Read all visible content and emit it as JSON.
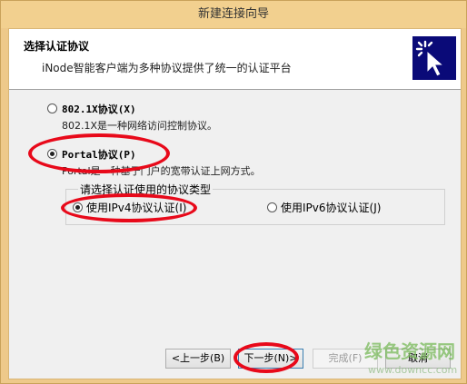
{
  "window": {
    "title": "新建连接向导"
  },
  "header": {
    "title": "选择认证协议",
    "subtitle": "iNode智能客户端为多种协议提供了统一的认证平台",
    "logo_icon": "cursor-click-icon",
    "logo_color": "#0a0a78"
  },
  "options": {
    "x8021": {
      "label": "802.1X协议(X)",
      "desc": "802.1X是一种网络访问控制协议。",
      "selected": false
    },
    "portal": {
      "label": "Portal协议(P)",
      "desc": "Portal是一种基于门户的宽带认证上网方式。",
      "selected": true
    }
  },
  "protocol_group": {
    "title": "请选择认证使用的协议类型",
    "ipv4": {
      "label": "使用IPv4协议认证(I)",
      "selected": true
    },
    "ipv6": {
      "label": "使用IPv6协议认证(J)",
      "selected": false
    }
  },
  "buttons": {
    "back": "<上一步(B)",
    "next": "下一步(N)>",
    "finish": "完成(F)",
    "cancel": "取消"
  },
  "watermark": {
    "title": "绿色资源网",
    "url": "www.downcc.com"
  },
  "colors": {
    "annotation_red": "#e8091a",
    "titlebar": "#f2d08f"
  }
}
